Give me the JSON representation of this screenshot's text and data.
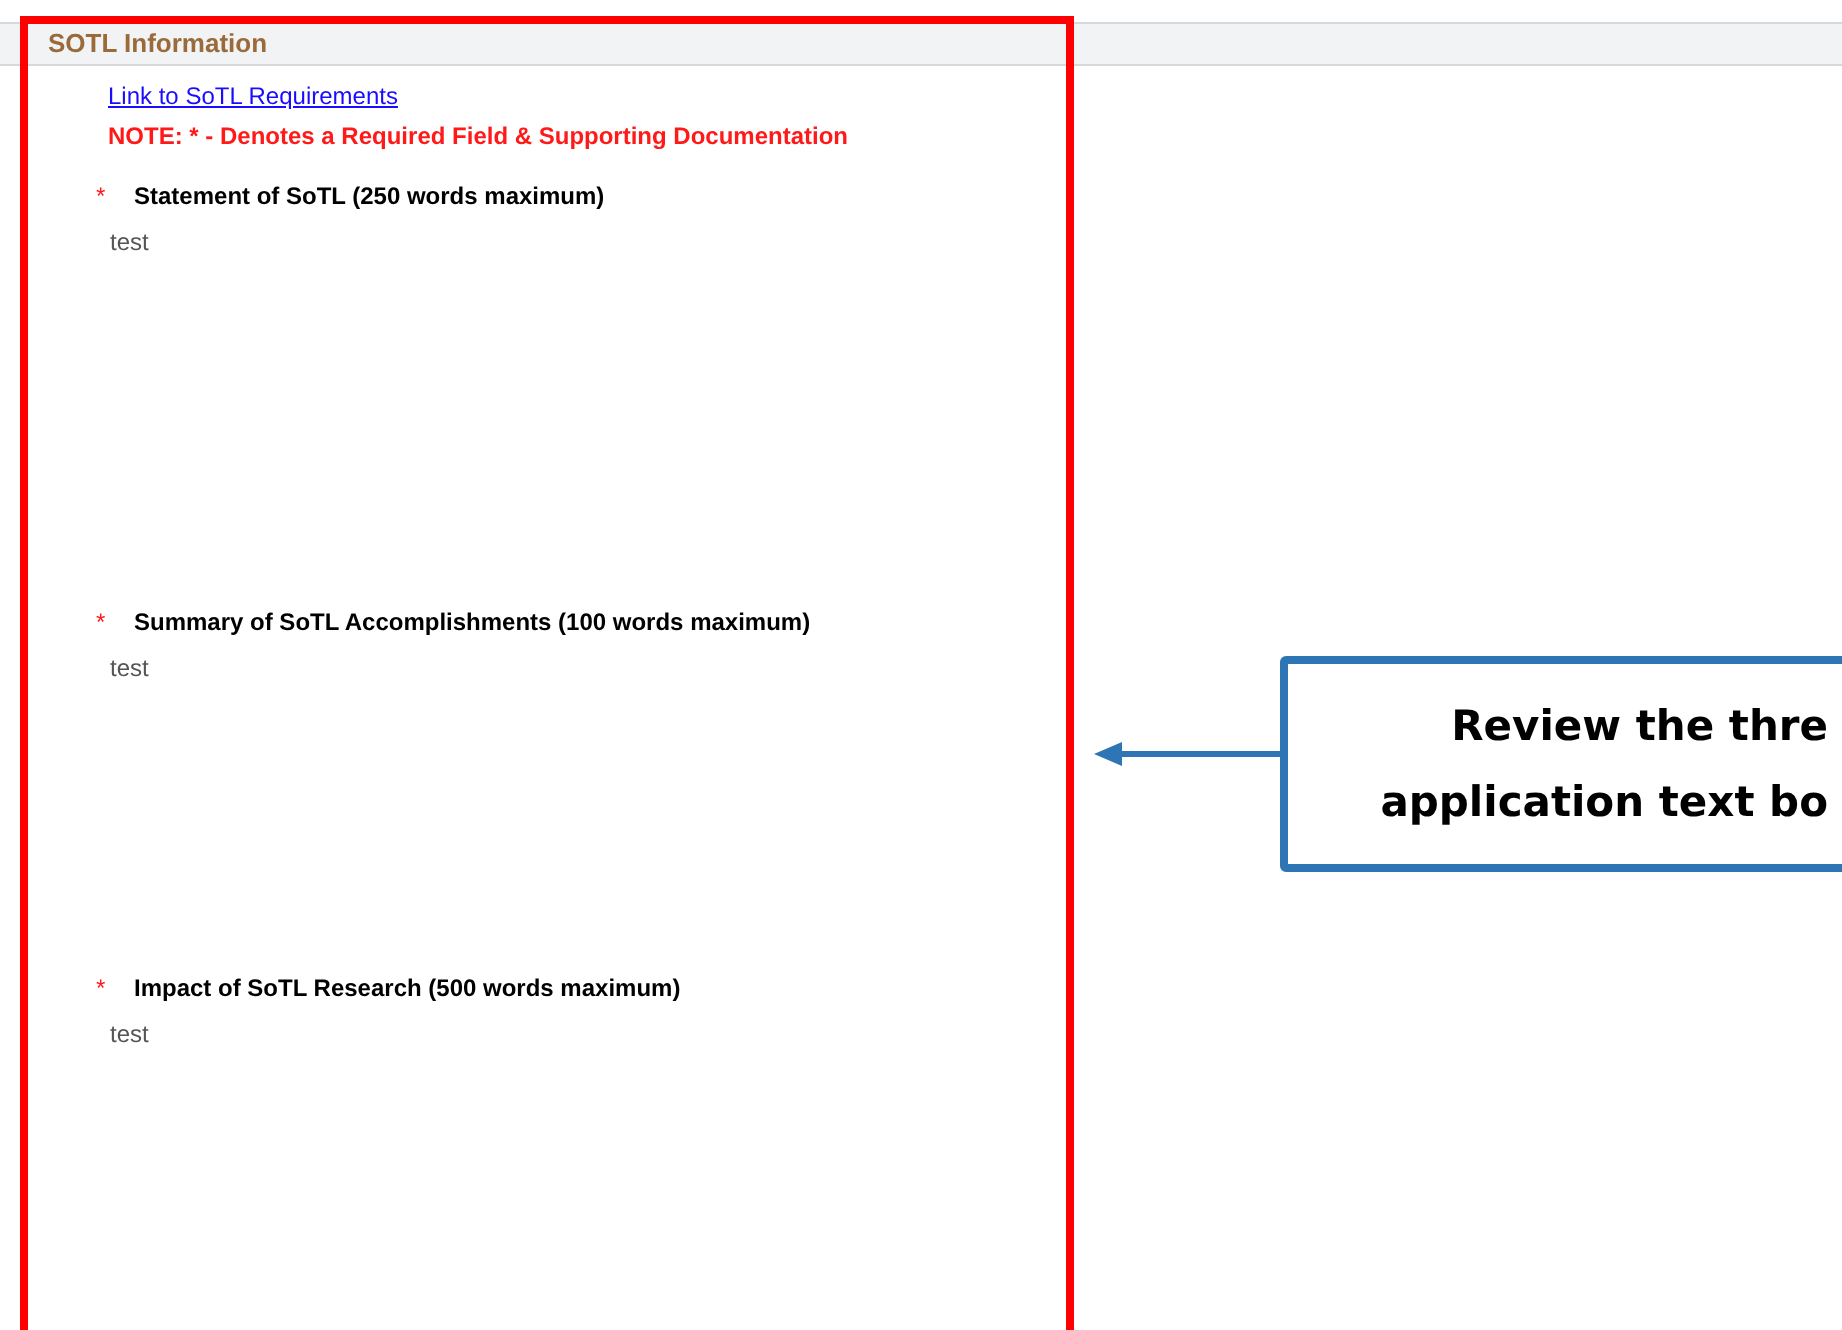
{
  "section": {
    "title": "SOTL Information"
  },
  "link": "Link to SoTL Requirements",
  "note": "NOTE: * - Denotes a Required Field & Supporting Documentation",
  "fields": [
    {
      "required": true,
      "marker": "*",
      "label": "Statement of SoTL (250 words maximum)",
      "value": "test"
    },
    {
      "required": true,
      "marker": "*",
      "label": "Summary of SoTL Accomplishments (100 words maximum)",
      "value": "test"
    },
    {
      "required": true,
      "marker": "*",
      "label": "Impact of SoTL Research (500 words maximum)",
      "value": "test"
    }
  ],
  "callout": {
    "lines": [
      "Review the thre",
      "application text bo"
    ]
  }
}
